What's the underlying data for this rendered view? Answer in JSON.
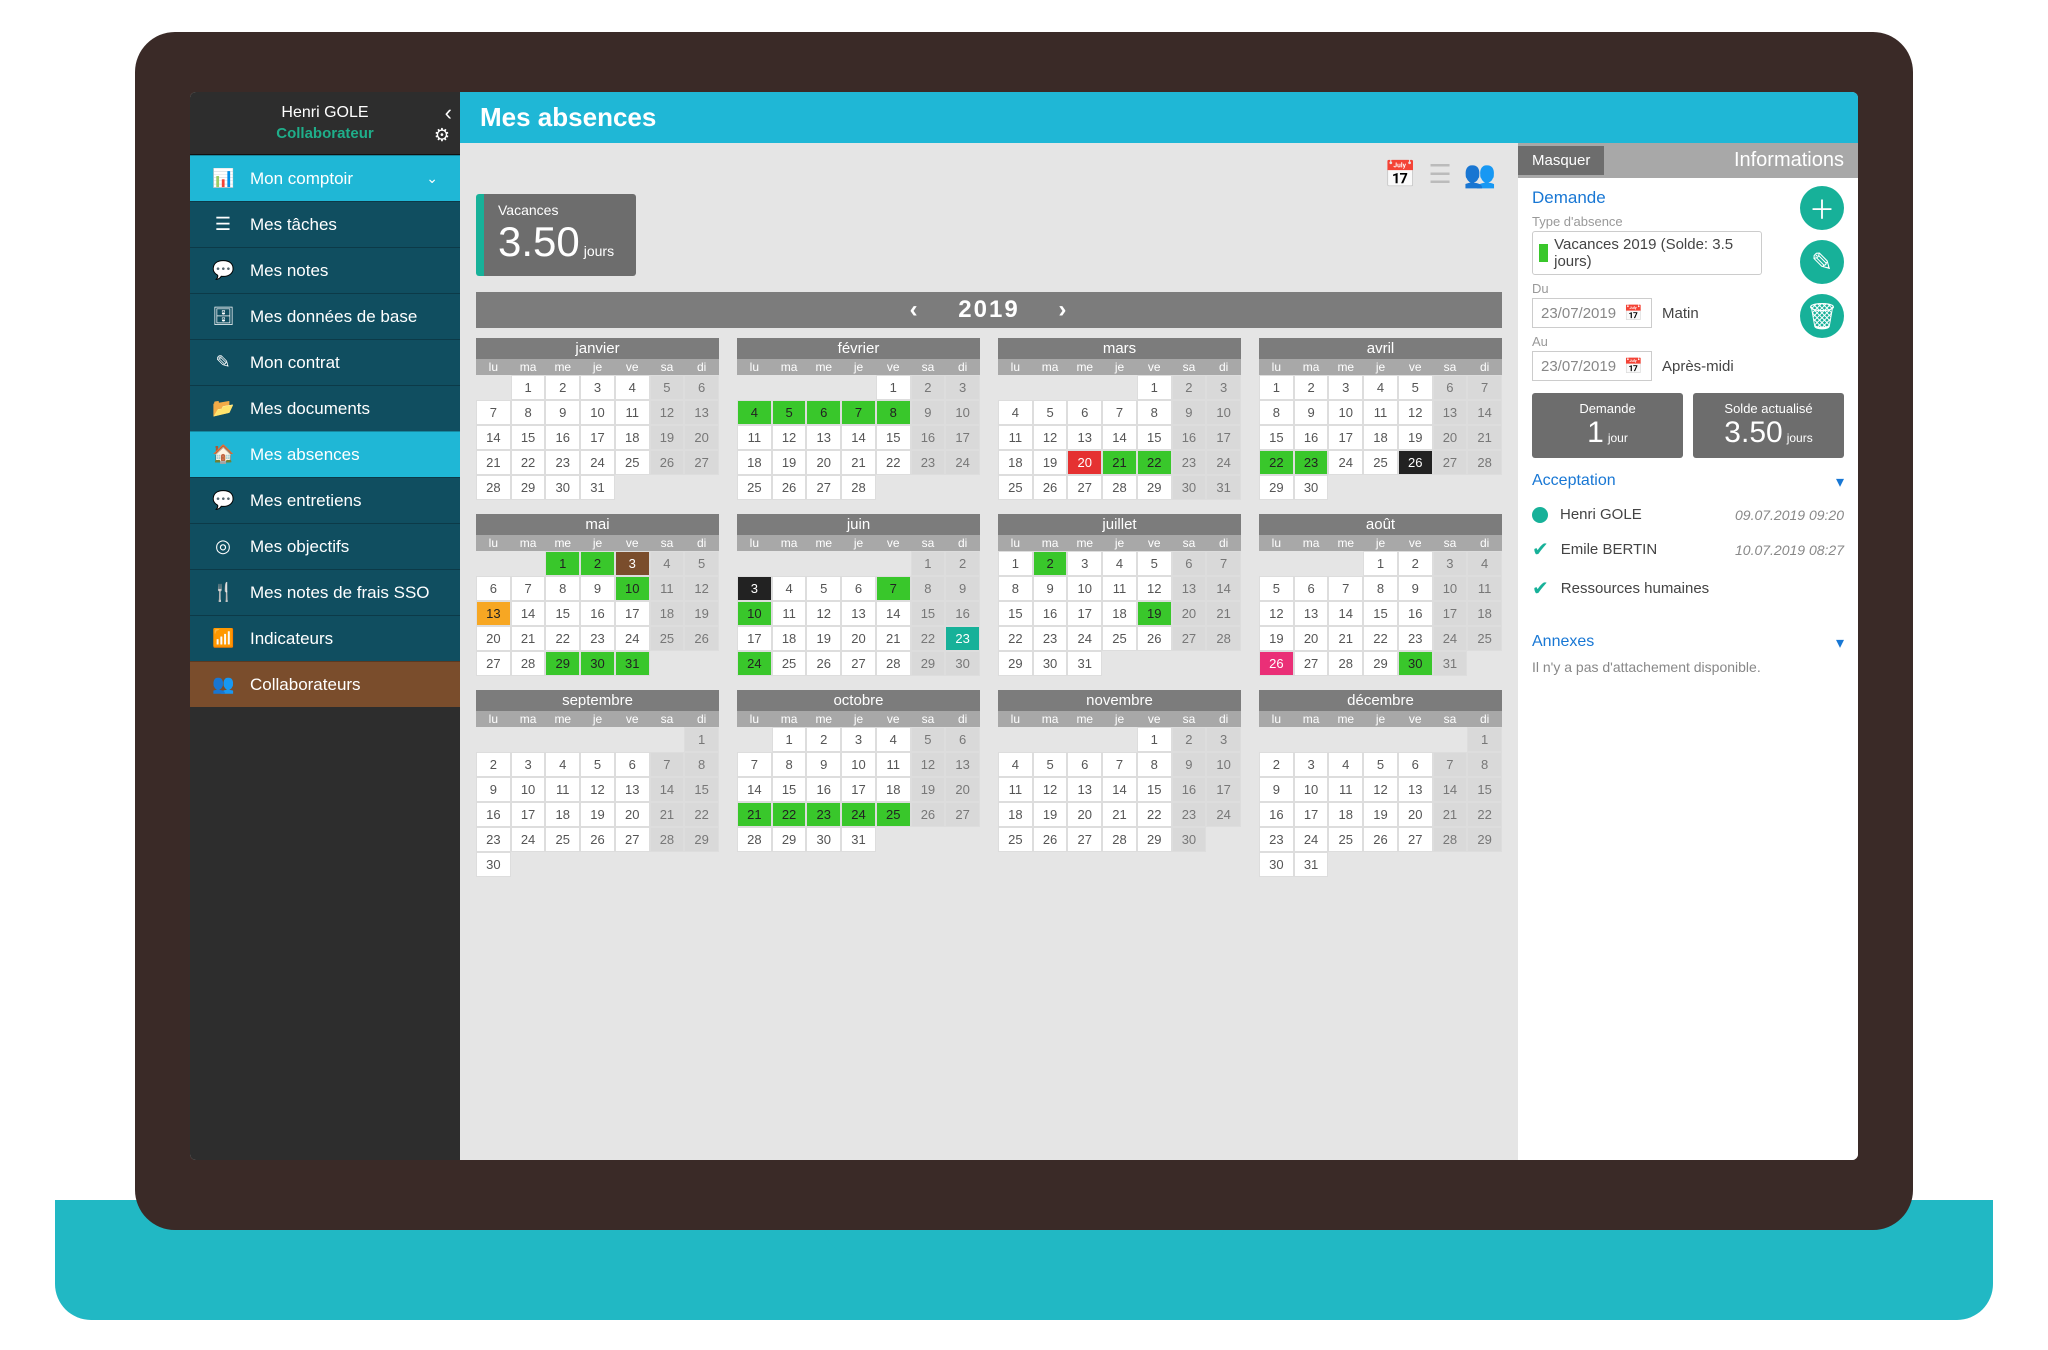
{
  "sidebar": {
    "user": "Henri GOLE",
    "role": "Collaborateur",
    "items": [
      {
        "icon": "📊",
        "label": "Mon comptoir",
        "parent": true,
        "cls": "hi"
      },
      {
        "icon": "☰",
        "label": "Mes tâches"
      },
      {
        "icon": "💬",
        "label": "Mes notes"
      },
      {
        "icon": "🗄",
        "label": "Mes données de base"
      },
      {
        "icon": "✎",
        "label": "Mon contrat"
      },
      {
        "icon": "📂",
        "label": "Mes documents"
      },
      {
        "icon": "🏠",
        "label": "Mes absences",
        "cls": "hi"
      },
      {
        "icon": "💬",
        "label": "Mes entretiens"
      },
      {
        "icon": "◎",
        "label": "Mes objectifs"
      },
      {
        "icon": "🍴",
        "label": "Mes notes de frais SSO"
      },
      {
        "icon": "📶",
        "label": "Indicateurs"
      },
      {
        "icon": "👥",
        "label": "Collaborateurs",
        "cls": "collab"
      }
    ]
  },
  "title": "Mes absences",
  "vacCard": {
    "title": "Vacances",
    "value": "3.50",
    "unit": "jours"
  },
  "year": "2019",
  "dows": [
    "lu",
    "ma",
    "me",
    "je",
    "ve",
    "sa",
    "di"
  ],
  "months": [
    {
      "name": "janvier",
      "lead": 1,
      "days": 31,
      "marks": {}
    },
    {
      "name": "février",
      "lead": 4,
      "days": 28,
      "marks": {
        "4": "g",
        "5": "g",
        "6": "g",
        "7": "g",
        "8": "g"
      }
    },
    {
      "name": "mars",
      "lead": 4,
      "days": 31,
      "marks": {
        "20": "rd",
        "21": "g",
        "22": "g"
      }
    },
    {
      "name": "avril",
      "lead": 0,
      "days": 30,
      "marks": {
        "22": "g",
        "23": "g",
        "26": "bk"
      }
    },
    {
      "name": "mai",
      "lead": 2,
      "days": 31,
      "marks": {
        "1": "g",
        "2": "g",
        "3": "br",
        "10": "g",
        "13": "or",
        "29": "g",
        "30": "g",
        "31": "g"
      }
    },
    {
      "name": "juin",
      "lead": 5,
      "days": 30,
      "marks": {
        "3": "bk",
        "7": "g",
        "10": "g",
        "23": "t",
        "24": "g"
      }
    },
    {
      "name": "juillet",
      "lead": 0,
      "days": 31,
      "marks": {
        "2": "g",
        "19": "g"
      }
    },
    {
      "name": "août",
      "lead": 3,
      "days": 31,
      "marks": {
        "26": "pk",
        "30": "g"
      }
    },
    {
      "name": "septembre",
      "lead": 6,
      "days": 30,
      "marks": {}
    },
    {
      "name": "octobre",
      "lead": 1,
      "days": 31,
      "marks": {
        "21": "g",
        "22": "g",
        "23": "g",
        "24": "g",
        "25": "g"
      }
    },
    {
      "name": "novembre",
      "lead": 4,
      "days": 30,
      "marks": {}
    },
    {
      "name": "décembre",
      "lead": 6,
      "days": 31,
      "marks": {}
    }
  ],
  "panel": {
    "mask": "Masquer",
    "info": "Informations",
    "demande": "Demande",
    "typeLabel": "Type d'absence",
    "typeValue": "Vacances 2019 (Solde: 3.5 jours)",
    "duLabel": "Du",
    "du": "23/07/2019",
    "duHalf": "Matin",
    "auLabel": "Au",
    "au": "23/07/2019",
    "auHalf": "Après-midi",
    "tot1": {
      "t": "Demande",
      "v": "1",
      "u": "jour"
    },
    "tot2": {
      "t": "Solde actualisé",
      "v": "3.50",
      "u": "jours"
    },
    "accept": "Acceptation",
    "steps": [
      {
        "k": "dot",
        "name": "Henri GOLE",
        "date": "09.07.2019 09:20"
      },
      {
        "k": "chk",
        "name": "Emile BERTIN",
        "date": "10.07.2019 08:27"
      },
      {
        "k": "chk",
        "name": "Ressources humaines",
        "date": ""
      }
    ],
    "annex": "Annexes",
    "annexEmpty": "Il n'y a pas d'attachement disponible."
  }
}
